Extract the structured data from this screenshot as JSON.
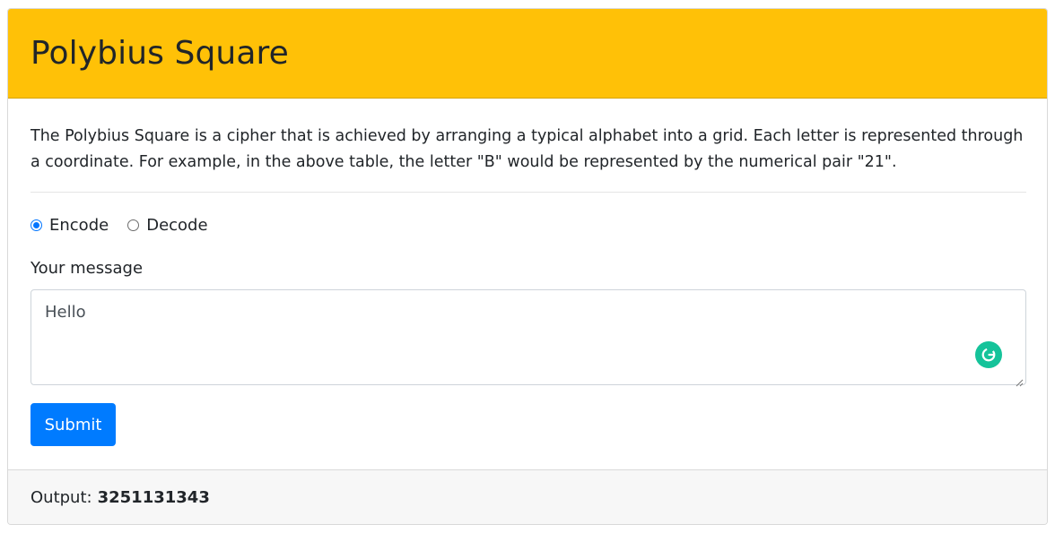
{
  "header": {
    "title": "Polybius Square",
    "background_color": "#ffc107"
  },
  "body": {
    "description": "The Polybius Square is a cipher that is achieved by arranging a typical alphabet into a grid. Each letter is represented through a coordinate. For example, in the above table, the letter \"B\" would be represented by the numerical pair \"21\".",
    "mode": {
      "options": [
        {
          "label": "Encode",
          "checked": true
        },
        {
          "label": "Decode",
          "checked": false
        }
      ]
    },
    "message": {
      "label": "Your message",
      "value": "Hello",
      "assistant_icon": "grammarly-icon"
    },
    "submit": {
      "label": "Submit",
      "color": "#007bff"
    }
  },
  "footer": {
    "output_label": "Output:",
    "output_value": "3251131343"
  }
}
